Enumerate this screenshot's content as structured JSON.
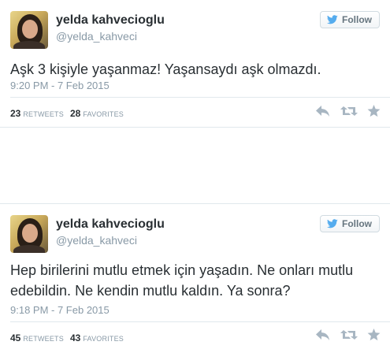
{
  "colors": {
    "text": "#292f33",
    "muted": "#8899a6",
    "icon": "#a8b6c2",
    "bird": "#55acee"
  },
  "tweets": [
    {
      "name": "yelda kahvecioglu",
      "handle": "@yelda_kahveci",
      "follow_label": "Follow",
      "text": "Aşk 3 kişiyle yaşanmaz! Yaşansaydı aşk olmazdı.",
      "timestamp": "9:20 PM - 7 Feb 2015",
      "retweets": "23",
      "retweets_label": "RETWEETS",
      "favorites": "28",
      "favorites_label": "FAVORITES"
    },
    {
      "name": "yelda kahvecioglu",
      "handle": "@yelda_kahveci",
      "follow_label": "Follow",
      "text": "Hep birilerini mutlu etmek için yaşadın. Ne onları mutlu edebildin. Ne kendin mutlu kaldın. Ya sonra?",
      "timestamp": "9:18 PM - 7 Feb 2015",
      "retweets": "45",
      "retweets_label": "RETWEETS",
      "favorites": "43",
      "favorites_label": "FAVORITES"
    }
  ],
  "icons": {
    "follow": "twitter-bird-icon",
    "reply": "reply-icon",
    "retweet": "retweet-icon",
    "favorite": "star-icon"
  }
}
